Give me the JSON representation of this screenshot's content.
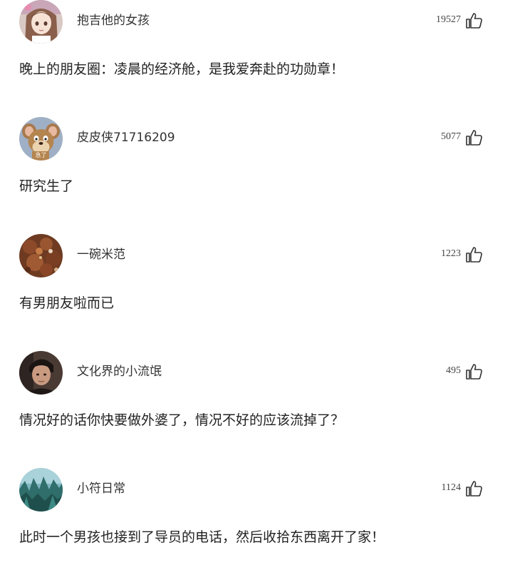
{
  "comments": [
    {
      "username": "抱吉他的女孩",
      "likes": "19527",
      "text": "晚上的朋友圈：凌晨的经济舱，是我爱奔赴的功勋章！",
      "avatar_icon": "anime-girl-avatar"
    },
    {
      "username": "皮皮侠71716209",
      "likes": "5077",
      "text": "研究生了",
      "avatar_icon": "cartoon-mouse-avatar",
      "avatar_caption": "急了"
    },
    {
      "username": "一碗米范",
      "likes": "1223",
      "text": "有男朋友啦而已",
      "avatar_icon": "food-dish-avatar"
    },
    {
      "username": "文化界的小流氓",
      "likes": "495",
      "text": "情况好的话你快要做外婆了，情况不好的应该流掉了？",
      "avatar_icon": "man-portrait-avatar"
    },
    {
      "username": "小符日常",
      "likes": "1124",
      "text": "此时一个男孩也接到了导员的电话，然后收拾东西离开了家！",
      "avatar_icon": "forest-scenery-avatar"
    }
  ],
  "like_icon": "thumbs-up-icon",
  "colors": {
    "text": "#222222",
    "username": "#333333",
    "count": "#444444",
    "icon_stroke": "#333333"
  }
}
